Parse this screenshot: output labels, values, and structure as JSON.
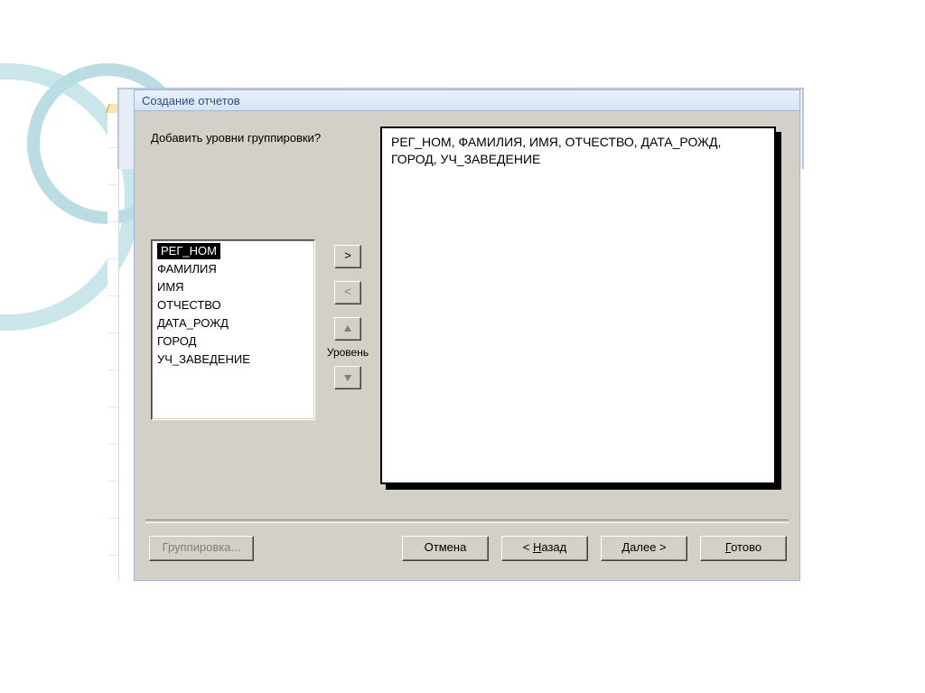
{
  "window": {
    "title": "Создание отчетов"
  },
  "main": {
    "prompt": "Добавить уровни группировки?",
    "fields": [
      "РЕГ_НОМ",
      "ФАМИЛИЯ",
      "ИМЯ",
      "ОТЧЕСТВО",
      "ДАТА_РОЖД",
      "ГОРОД",
      "УЧ_ЗАВЕДЕНИЕ"
    ],
    "selected_index": 0,
    "center": {
      "add_label": ">",
      "remove_label": "<",
      "priority_label": "Уровень"
    },
    "preview_text": "РЕГ_НОМ, ФАМИЛИЯ, ИМЯ, ОТЧЕСТВО, ДАТА_РОЖД, ГОРОД, УЧ_ЗАВЕДЕНИЕ"
  },
  "footer": {
    "grouping": "Группировка...",
    "cancel": "Отмена",
    "back_pre": "< ",
    "back_ul": "Н",
    "back_post": "азад",
    "next_ul": "Д",
    "next_post": "алее >",
    "finish_ul": "Г",
    "finish_post": "отово"
  }
}
